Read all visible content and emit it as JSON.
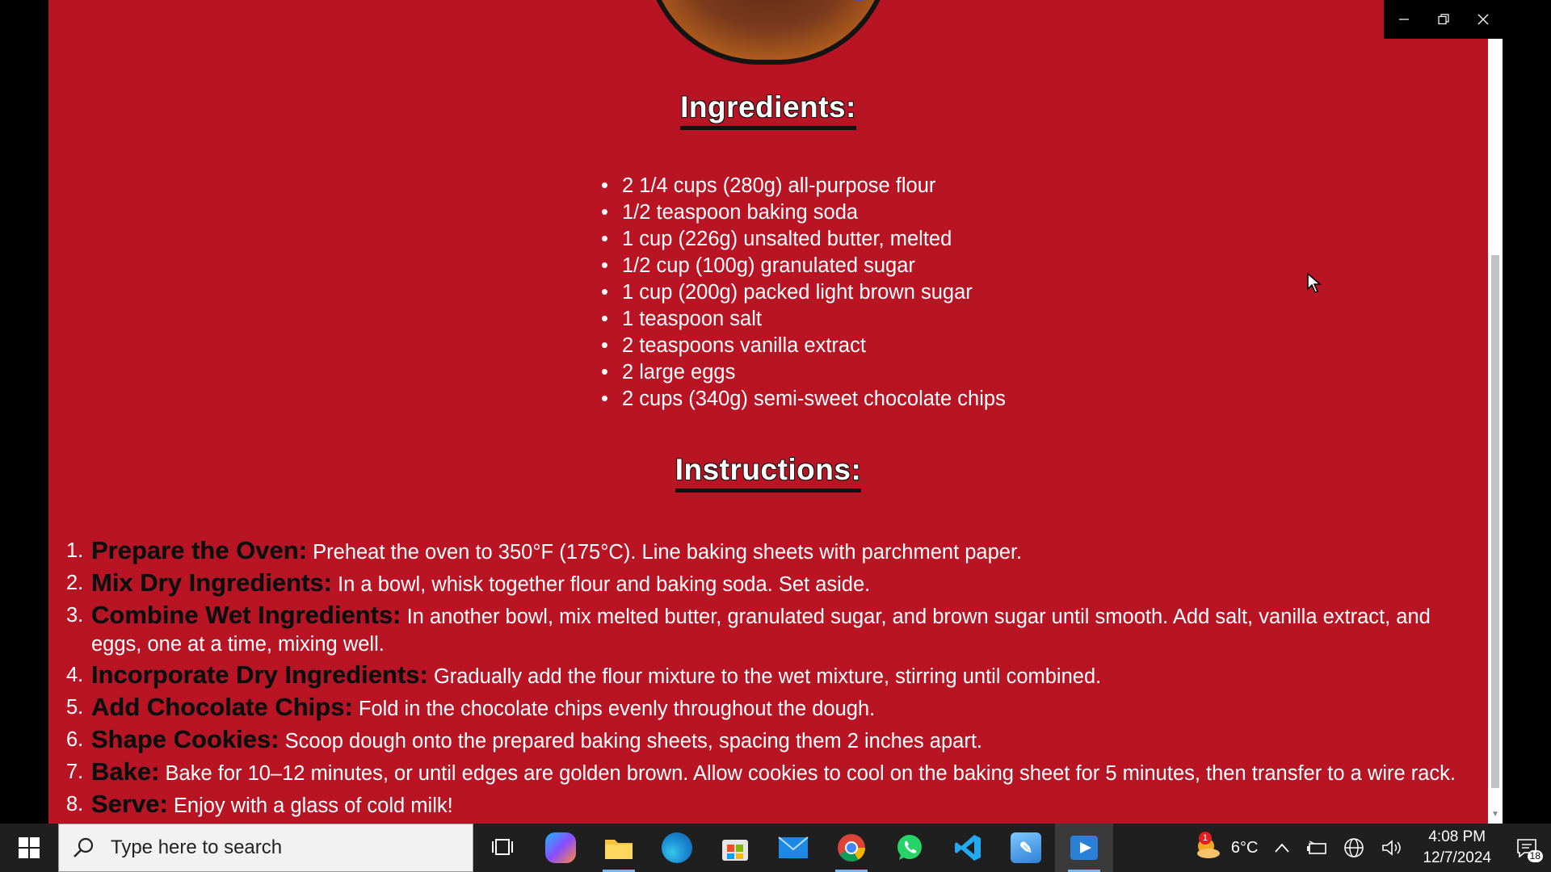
{
  "page": {
    "ingredients_heading": "Ingredients:",
    "ingredients": [
      "2 1/4 cups (280g) all-purpose flour",
      "1/2 teaspoon baking soda",
      "1 cup (226g) unsalted butter, melted",
      "1/2 cup (100g) granulated sugar",
      "1 cup (200g) packed light brown sugar",
      "1 teaspoon salt",
      "2 teaspoons vanilla extract",
      "2 large eggs",
      "2 cups (340g) semi-sweet chocolate chips"
    ],
    "instructions_heading": "Instructions:",
    "instructions": [
      {
        "num": "1.",
        "title": "Prepare the Oven:",
        "text": " Preheat the oven to 350°F (175°C). Line baking sheets with parchment paper."
      },
      {
        "num": "2.",
        "title": "Mix Dry Ingredients:",
        "text": " In a bowl, whisk together flour and baking soda. Set aside."
      },
      {
        "num": "3.",
        "title": "Combine Wet Ingredients:",
        "text": " In another bowl, mix melted butter, granulated sugar, and brown sugar until smooth. Add salt, vanilla extract, and eggs, one at a time, mixing well."
      },
      {
        "num": "4.",
        "title": "Incorporate Dry Ingredients:",
        "text": " Gradually add the flour mixture to the wet mixture, stirring until combined."
      },
      {
        "num": "5.",
        "title": "Add Chocolate Chips:",
        "text": " Fold in the chocolate chips evenly throughout the dough."
      },
      {
        "num": "6.",
        "title": "Shape Cookies:",
        "text": " Scoop dough onto the prepared baking sheets, spacing them 2 inches apart."
      },
      {
        "num": "7.",
        "title": "Bake:",
        "text": " Bake for 10–12 minutes, or until edges are golden brown. Allow cookies to cool on the baking sheet for 5 minutes, then transfer to a wire rack."
      },
      {
        "num": "8.",
        "title": "Serve:",
        "text": " Enjoy with a glass of cold milk!"
      }
    ],
    "background_color": "#b91424"
  },
  "window_controls": {
    "minimize": "minimize-icon",
    "restore": "restore-icon",
    "close": "close-icon"
  },
  "taskbar": {
    "search_placeholder": "Type here to search",
    "apps": [
      {
        "name": "task-view",
        "icon": "task-view-icon"
      },
      {
        "name": "copilot",
        "icon": "copilot-icon"
      },
      {
        "name": "file-explorer",
        "icon": "folder-icon"
      },
      {
        "name": "edge",
        "icon": "edge-icon"
      },
      {
        "name": "microsoft-store",
        "icon": "store-icon"
      },
      {
        "name": "mail",
        "icon": "mail-icon"
      },
      {
        "name": "chrome",
        "icon": "chrome-icon"
      },
      {
        "name": "whatsapp",
        "icon": "whatsapp-icon"
      },
      {
        "name": "vscode",
        "icon": "vscode-icon"
      },
      {
        "name": "paint-app",
        "icon": "paint-icon"
      },
      {
        "name": "media-player",
        "icon": "media-player-icon"
      }
    ],
    "weather": {
      "temp": "6°C",
      "badge": "1"
    },
    "clock": {
      "time": "4:08 PM",
      "date": "12/7/2024"
    },
    "notifications": "18"
  }
}
